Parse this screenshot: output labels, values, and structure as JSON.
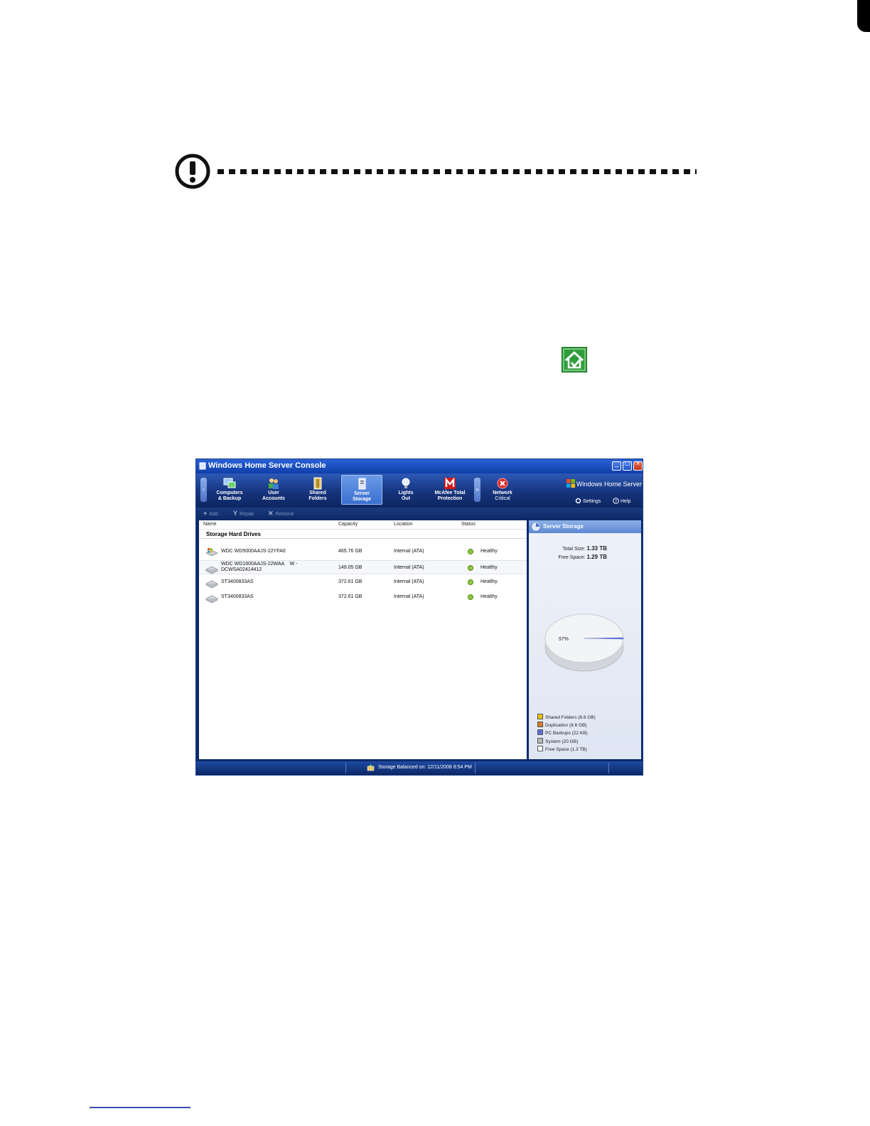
{
  "window": {
    "title": "Windows Home Server Console",
    "controls": {
      "minimize": "_",
      "maximize": "□",
      "close": "×"
    }
  },
  "nav": {
    "items": [
      {
        "label": "Computers\n& Backup",
        "icon": "computers-icon"
      },
      {
        "label": "User\nAccounts",
        "icon": "users-icon"
      },
      {
        "label": "Shared\nFolders",
        "icon": "shared-folders-icon"
      },
      {
        "label": "Server\nStorage",
        "icon": "server-storage-icon",
        "active": true
      },
      {
        "label": "Lights\nOut",
        "icon": "lightbulb-icon"
      },
      {
        "label": "McAfee Total\nProtection",
        "icon": "mcafee-icon"
      }
    ],
    "network": {
      "label": "Network",
      "status": "Critical"
    },
    "brand": "Windows Home Server",
    "settings": "Settings",
    "help": "Help"
  },
  "commands": {
    "add": "Add",
    "repair": "Repair",
    "remove": "Remove"
  },
  "table": {
    "columns": [
      "Name",
      "Capacity",
      "Location",
      "Status"
    ],
    "group_title": "Storage Hard Drives",
    "rows": [
      {
        "name": "WDC WD5000AAJS-22YFA0",
        "capacity": "465.76 GB",
        "location": "Internal (ATA)",
        "status": "Healthy"
      },
      {
        "name": "WDC WD1600AAJS-22WAA    W -\nDCWSA02414412",
        "capacity": "149.05 GB",
        "location": "Internal (ATA)",
        "status": "Healthy"
      },
      {
        "name": "ST3400833AS",
        "capacity": "372.61 GB",
        "location": "Internal (ATA)",
        "status": "Healthy"
      },
      {
        "name": "ST3400833AS",
        "capacity": "372.61 GB",
        "location": "Internal (ATA)",
        "status": "Healthy"
      }
    ]
  },
  "side": {
    "title": "Server Storage",
    "total_label": "Total Size:",
    "total_value": "1.33 TB",
    "free_label": "Free Space:",
    "free_value": "1.29 TB",
    "pie_label": "97%",
    "legend": [
      {
        "label": "Shared Folders (8.6 GB)",
        "color": "#f2c200"
      },
      {
        "label": "Duplication (8.6 GB)",
        "color": "#e07a1f"
      },
      {
        "label": "PC Backups (22 KB)",
        "color": "#5a6fd6"
      },
      {
        "label": "System (20 GB)",
        "color": "#b8b8b8"
      },
      {
        "label": "Free Space (1.3 TB)",
        "color": "#ffffff"
      }
    ]
  },
  "statusbar": {
    "text": "Storage Balanced on: 12/11/2008 8:54 PM"
  },
  "colors": {
    "accent": "#2a62d6",
    "healthy": "#8cc63f",
    "home_icon": "#2f9e3a"
  }
}
